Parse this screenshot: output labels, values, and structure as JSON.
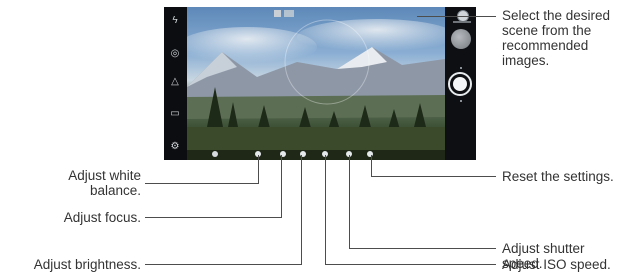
{
  "callouts": {
    "scene": "Select the desired scene from the recommended images.",
    "scene_lines": [
      "Select the desired",
      "scene from the",
      "recommended",
      "images."
    ],
    "white_balance_lines": [
      "Adjust white",
      "balance."
    ],
    "focus": "Adjust focus.",
    "brightness": "Adjust brightness.",
    "reset": "Reset the settings.",
    "shutter_speed_lines": [
      "Adjust shutter",
      "speed."
    ],
    "iso": "Adjust ISO speed."
  },
  "screen": {
    "sidebar_icons": [
      "flash-icon",
      "switch-camera-icon",
      "filter-icon",
      "ratio-icon",
      "settings-icon"
    ],
    "controls": [
      "scene-selector-icon",
      "gallery-thumbnail",
      "shutter-button"
    ],
    "bottom_bar_icons": [
      "auto-icon",
      "white-balance-icon",
      "focus-icon",
      "brightness-icon",
      "iso-icon",
      "shutter-speed-icon",
      "reset-icon"
    ]
  }
}
